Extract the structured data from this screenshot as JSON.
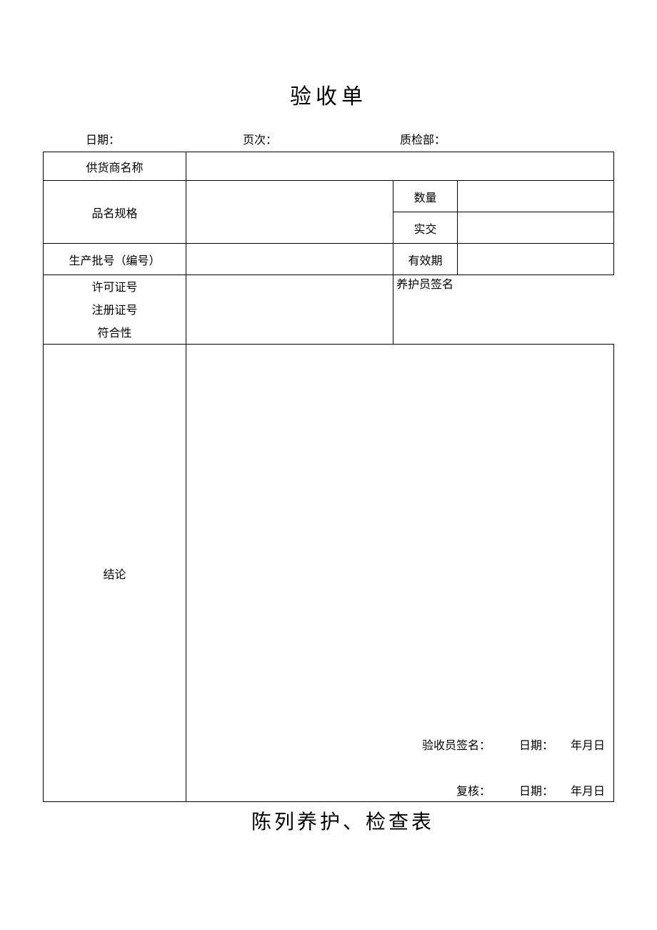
{
  "title": "验收单",
  "meta": {
    "date_label": "日期：",
    "page_label": "页次：",
    "dept_label": "质检部："
  },
  "rows": {
    "supplier": "供货商名称",
    "spec": "品名规格",
    "qty": "数量",
    "actual": "实交",
    "batch": "生产批号（编号）",
    "valid": "有效期",
    "license": "许可证号",
    "register": "注册证号",
    "compliance": "符合性",
    "caretaker_sig": "养护员签名",
    "conclusion": "结论"
  },
  "signoff": {
    "inspector": "验收员签名：",
    "reviewer": "复核：",
    "date_label": "日期：",
    "ymd": "年月日"
  },
  "title2": "陈列养护、检查表"
}
